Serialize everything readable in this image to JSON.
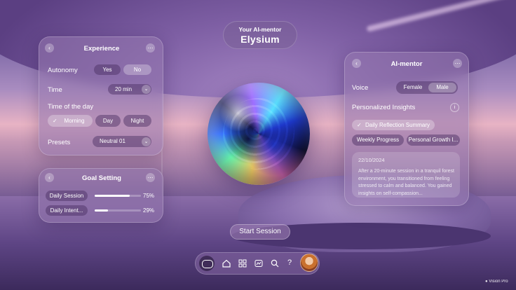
{
  "header": {
    "subtitle": "Your AI-mentor",
    "title": "Elysium"
  },
  "experience": {
    "title": "Experience",
    "back_icon": "chevron-left-icon",
    "more_icon": "ellipsis-icon",
    "autonomy_label": "Autonomy",
    "autonomy_options": [
      "Yes",
      "No"
    ],
    "autonomy_selected": "No",
    "time_label": "Time",
    "time_value": "20 min",
    "time_of_day_label": "Time of the day",
    "time_of_day_options": [
      "Morning",
      "Day",
      "Night"
    ],
    "time_of_day_selected": "Morning",
    "presets_label": "Presets",
    "presets_value": "Neutral 01"
  },
  "goal_setting": {
    "title": "Goal Setting",
    "items": [
      {
        "label": "Daily Session",
        "percent_text": "75%",
        "progress": 0.75
      },
      {
        "label": "Daily Intent...",
        "percent_text": "29%",
        "progress": 0.29
      }
    ]
  },
  "ai_mentor": {
    "title": "AI-mentor",
    "voice_label": "Voice",
    "voice_options": [
      "Female",
      "Male"
    ],
    "voice_selected": "Male",
    "insights_label": "Personalized Insights",
    "insights_chips": [
      "Daily Reflection Summary",
      "Weekly Progress",
      "Personal Growth I..."
    ],
    "insights_selected": "Daily Reflection Summary",
    "note_date": "22/10/2024",
    "note_text": "After a 20-minute session in a tranquil forest environment, you transitioned from feeling stressed to calm and balanced. You gained insights on self-compassion..."
  },
  "start_button": "Start Session",
  "dock": {
    "items": [
      "toggle-icon",
      "home-icon",
      "grid-icon",
      "chart-icon",
      "search-icon",
      "help-icon",
      "avatar"
    ],
    "help_glyph": "?"
  },
  "badge": "Vision Pro",
  "colors": {
    "panel": "#9678af",
    "selected": "#ffffff"
  }
}
